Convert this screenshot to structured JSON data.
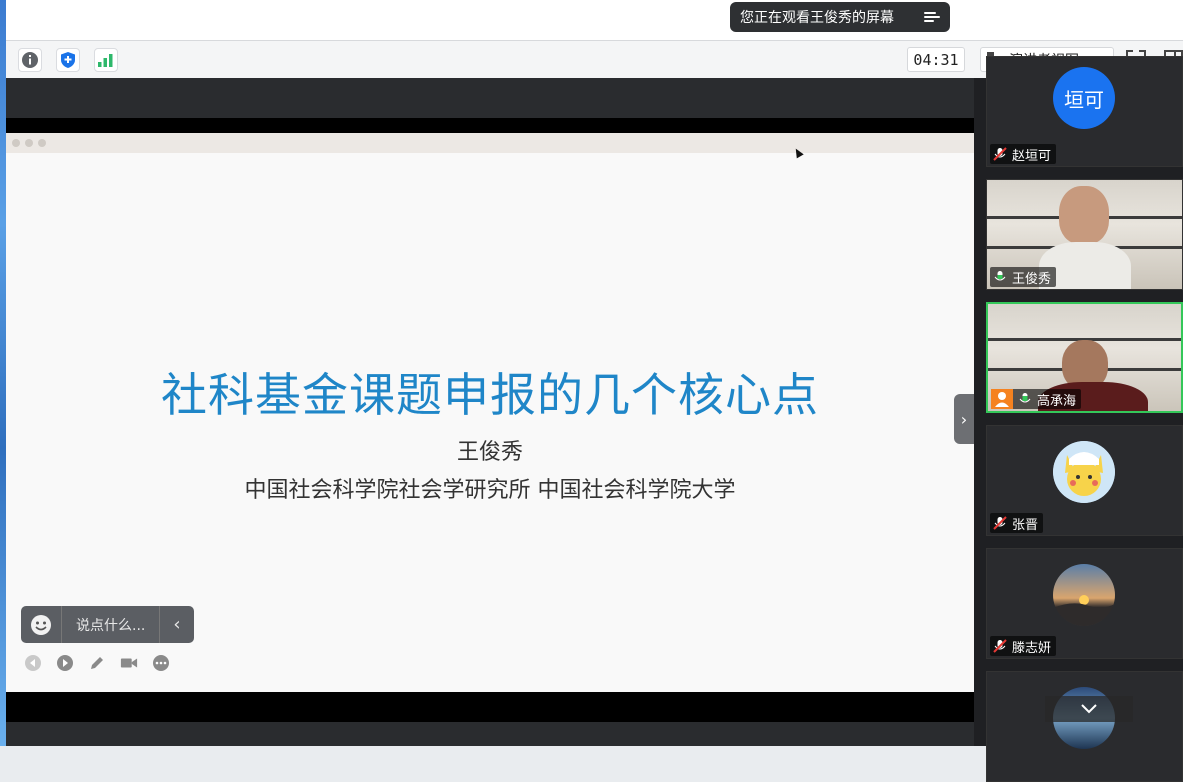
{
  "banner": {
    "text": "您正在观看王俊秀的屏幕"
  },
  "toolbar": {
    "timer": "04:31",
    "view_label": "演讲者视图",
    "icons": [
      "info-icon",
      "shield-icon",
      "signal-icon",
      "fullscreen-icon",
      "layout-icon"
    ]
  },
  "slide": {
    "title": "社科基金课题申报的几个核心点",
    "author": "王俊秀",
    "affiliation": "中国社会科学院社会学研究所 中国社会科学院大学"
  },
  "chat": {
    "placeholder": "说点什么..."
  },
  "participants": [
    {
      "name": "赵垣可",
      "avatar_text": "垣可",
      "mic": "muted",
      "avatar_color": "#1a73f0"
    },
    {
      "name": "王俊秀",
      "mic": "on",
      "video": true
    },
    {
      "name": "高承海",
      "mic": "on",
      "video": true,
      "speaking": true
    },
    {
      "name": "张晋",
      "mic": "muted"
    },
    {
      "name": "滕志妍",
      "mic": "muted"
    }
  ],
  "colors": {
    "title_blue": "#1f86c8",
    "active_green": "#34c759",
    "muted_red": "#e53935"
  }
}
